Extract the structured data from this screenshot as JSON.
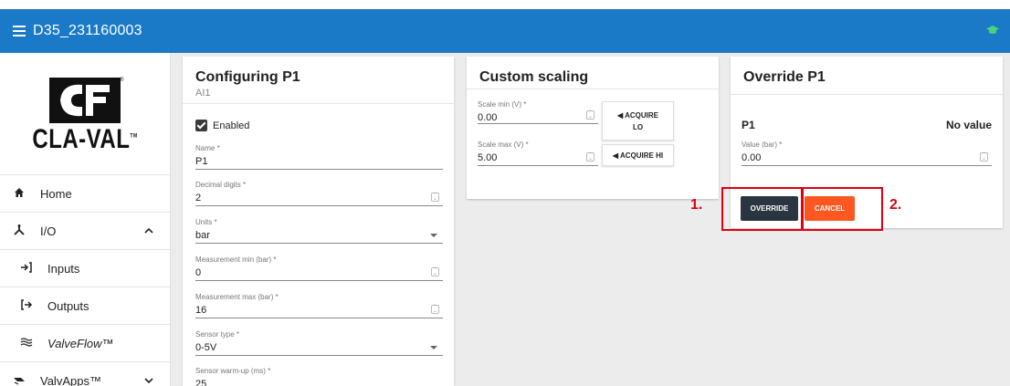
{
  "appbar": {
    "title": "D35_231160003"
  },
  "logo": {
    "text": "CLA-VAL",
    "registered": "®",
    "tm": "TM"
  },
  "sidebar": {
    "items": [
      {
        "label": "Home",
        "icon": "home-icon"
      },
      {
        "label": "I/O",
        "icon": "io-icon"
      },
      {
        "label": "Inputs",
        "icon": "input-arrow-icon"
      },
      {
        "label": "Outputs",
        "icon": "output-arrow-icon"
      },
      {
        "label": "ValveFlow™",
        "icon": "valveflow-icon"
      },
      {
        "label": "ValvApps™",
        "icon": "valvapps-icon"
      }
    ]
  },
  "config": {
    "title": "Configuring P1",
    "subtitle": "AI1",
    "enabled_label": "Enabled",
    "fields": [
      {
        "label": "Name *",
        "value": "P1"
      },
      {
        "label": "Decimal digits *",
        "value": "2"
      },
      {
        "label": "Units *",
        "value": "bar"
      },
      {
        "label": "Measurement min (bar) *",
        "value": "0"
      },
      {
        "label": "Measurement max (bar) *",
        "value": "16"
      },
      {
        "label": "Sensor type *",
        "value": "0-5V"
      },
      {
        "label": "Sensor warm-up (ms) *",
        "value": "25"
      }
    ]
  },
  "scaling": {
    "title": "Custom scaling",
    "min_label": "Scale min (V) *",
    "min_value": "0.00",
    "max_label": "Scale max (V) *",
    "max_value": "5.00",
    "acquire_lo": "◀ ACQUIRE LO",
    "acquire_hi": "◀ ACQUIRE HI"
  },
  "override": {
    "title": "Override P1",
    "param": "P1",
    "status": "No value",
    "value_label": "Value (bar) *",
    "value": "0.00",
    "override_btn": "OVERRIDE",
    "cancel_btn": "CANCEL"
  },
  "annotations": {
    "one": "1.",
    "two": "2.",
    "color": "#e0000f"
  },
  "colors": {
    "appbar": "#1a7ac8",
    "cancel": "#ff5722",
    "override": "#2a3540"
  }
}
